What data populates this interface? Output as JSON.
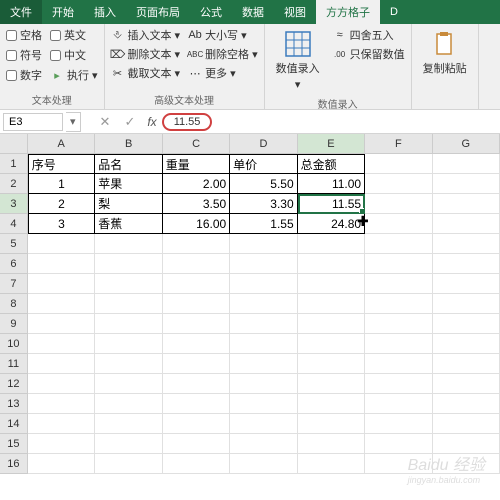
{
  "tabs": {
    "file": "文件",
    "items": [
      "开始",
      "插入",
      "页面布局",
      "公式",
      "数据",
      "视图",
      "方方格子",
      "D"
    ],
    "active_index": 6
  },
  "ribbon": {
    "group1": {
      "label": "文本处理",
      "checks_left": [
        "空格",
        "符号",
        "数字"
      ],
      "checks_right": [
        "英文",
        "中文",
        "执行"
      ]
    },
    "group2": {
      "label": "高级文本处理",
      "btns_a": [
        {
          "icon": "↕",
          "label": "插入文本"
        },
        {
          "icon": "✕",
          "label": "删除文本"
        },
        {
          "icon": "✂",
          "label": "截取文本"
        }
      ],
      "btns_b": [
        {
          "icon": "Ab",
          "label": "大小写"
        },
        {
          "icon": "ABC",
          "label": "删除空格"
        },
        {
          "icon": "⋯",
          "label": "更多"
        }
      ]
    },
    "group3": {
      "label": "数值录入",
      "big": "数值录入",
      "btns": [
        {
          "icon": "⇄",
          "label": "四舍五入"
        },
        {
          "icon": ".00",
          "label": "只保留数值"
        }
      ]
    },
    "group4": {
      "big": "复制粘贴"
    }
  },
  "formula_bar": {
    "name_box": "E3",
    "value": "11.55"
  },
  "grid": {
    "cols": [
      "A",
      "B",
      "C",
      "D",
      "E",
      "F",
      "G"
    ],
    "selected_col": 4,
    "selected_row": 3,
    "rows": 16,
    "headers": [
      "序号",
      "品名",
      "重量",
      "单价",
      "总金额"
    ],
    "data": [
      [
        "1",
        "苹果",
        "2.00",
        "5.50",
        "11.00"
      ],
      [
        "2",
        "梨",
        "3.50",
        "3.30",
        "11.55"
      ],
      [
        "3",
        "香蕉",
        "16.00",
        "1.55",
        "24.80"
      ]
    ]
  },
  "watermark": {
    "big": "Baidu 经验",
    "small": "jingyan.baidu.com"
  }
}
